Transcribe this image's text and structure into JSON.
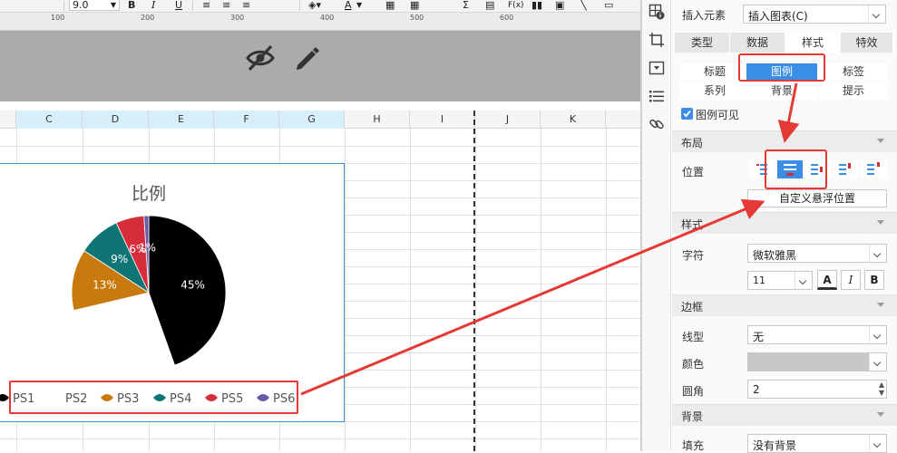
{
  "toolbar": {
    "font_size": "9.0",
    "bold_label": "B",
    "italic_label": "I",
    "underline_label": "U",
    "font_color_label": "A",
    "formula_label": "F(x)"
  },
  "ruler": {
    "labels": [
      "100",
      "200",
      "300",
      "400",
      "500",
      "600"
    ]
  },
  "sheet": {
    "columns": [
      "C",
      "D",
      "E",
      "F",
      "G",
      "H",
      "I",
      "J",
      "K"
    ]
  },
  "chart_data": {
    "type": "pie",
    "title": "比例",
    "slices": [
      {
        "name": "PS1",
        "value": 45,
        "label": "45%",
        "color": "#000000"
      },
      {
        "name": "PS2",
        "value": 27,
        "label": "",
        "color": "#ffffff"
      },
      {
        "name": "PS3",
        "value": 13,
        "label": "13%",
        "color": "#c87a0e"
      },
      {
        "name": "PS4",
        "value": 9,
        "label": "9%",
        "color": "#0f7574"
      },
      {
        "name": "PS5",
        "value": 6,
        "label": "6%",
        "color": "#d62d3b"
      },
      {
        "name": "PS6",
        "value": 1,
        "label": "1%",
        "color": "#6a5aa8"
      }
    ],
    "legend": [
      "PS1",
      "PS2",
      "PS3",
      "PS4",
      "PS5",
      "PS6"
    ],
    "legend_position": "bottom"
  },
  "panel": {
    "insert_element_label": "插入元素",
    "insert_element_value": "插入图表(C)",
    "tabs": [
      "类型",
      "数据",
      "样式",
      "特效"
    ],
    "active_tab": "样式",
    "subtabs": [
      "标题",
      "图例",
      "标签",
      "系列",
      "背景",
      "提示"
    ],
    "active_subtab": "图例",
    "legend_visible_label": "图例可见",
    "legend_visible": true,
    "layout_section": "布局",
    "position_label": "位置",
    "custom_float_label": "自定义悬浮位置",
    "style_section": "样式",
    "font_label": "字符",
    "font_value": "微软雅黑",
    "font_size_value": "11",
    "bold_label": "B",
    "italic_label": "I",
    "font_color_label": "A",
    "border_section": "边框",
    "line_type_label": "线型",
    "line_type_value": "无",
    "color_label": "颜色",
    "radius_label": "圆角",
    "radius_value": "2",
    "background_section": "背景",
    "fill_label": "填充",
    "fill_value": "没有背景"
  },
  "colors": {
    "accent": "#3a8ee6",
    "highlight": "#e53935"
  }
}
